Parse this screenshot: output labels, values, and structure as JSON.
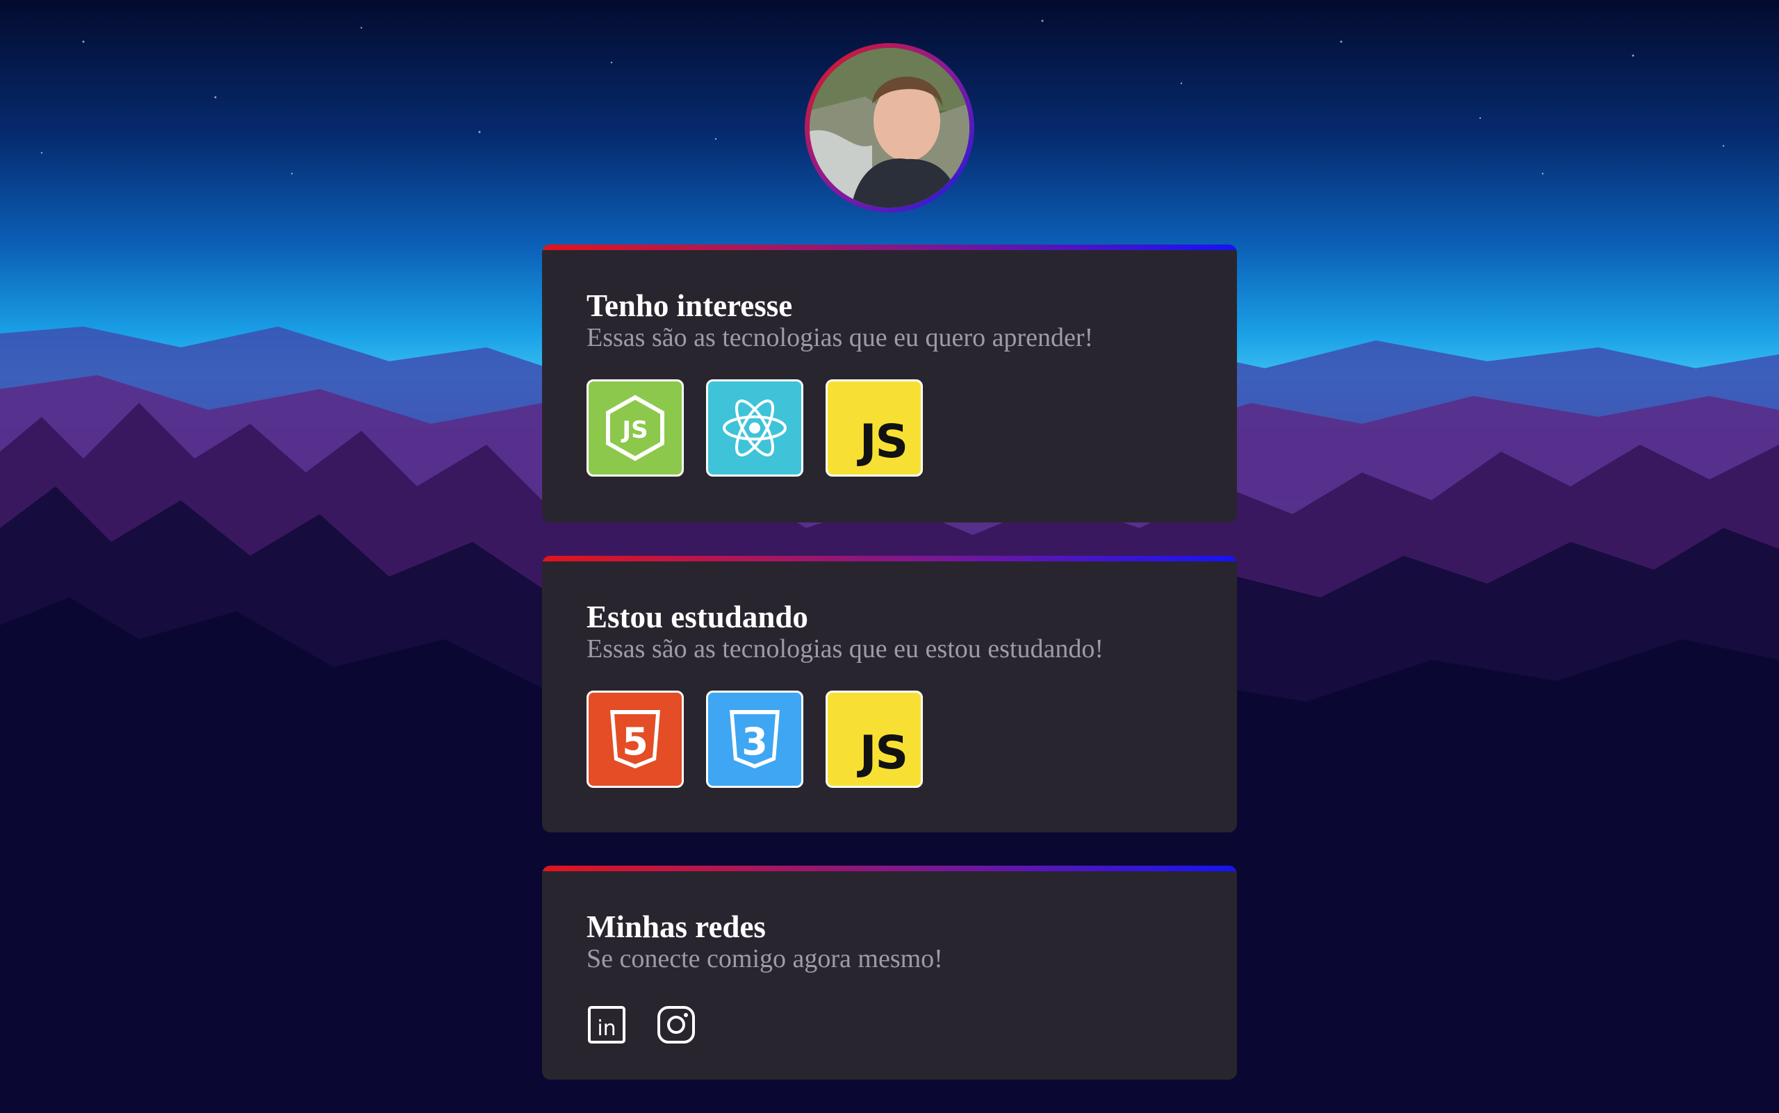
{
  "profile": {
    "avatar_alt": "Foto de perfil"
  },
  "sections": [
    {
      "title": "Tenho interesse",
      "subtitle": "Essas são as tecnologias que eu quero aprender!",
      "items": [
        {
          "icon": "nodejs-icon",
          "color": "#8cc84b"
        },
        {
          "icon": "react-icon",
          "color": "#3fc3d9"
        },
        {
          "icon": "javascript-icon",
          "color": "#f7e033",
          "label": "JS"
        }
      ]
    },
    {
      "title": "Estou estudando",
      "subtitle": "Essas são as tecnologias que eu estou estudando!",
      "items": [
        {
          "icon": "html5-icon",
          "color": "#e44d26",
          "label": "5"
        },
        {
          "icon": "css3-icon",
          "color": "#3ea6f2",
          "label": "3"
        },
        {
          "icon": "javascript-icon",
          "color": "#f7e033",
          "label": "JS"
        }
      ]
    },
    {
      "title": "Minhas redes",
      "subtitle": "Se conecte comigo agora mesmo!",
      "socials": [
        {
          "icon": "linkedin-icon",
          "label": "in"
        },
        {
          "icon": "instagram-icon"
        }
      ]
    }
  ],
  "colors": {
    "card_bg": "#29252f",
    "gradient_start": "#e3141b",
    "gradient_end": "#1414f5",
    "title": "#ffffff",
    "subtitle": "#a09aa6"
  }
}
